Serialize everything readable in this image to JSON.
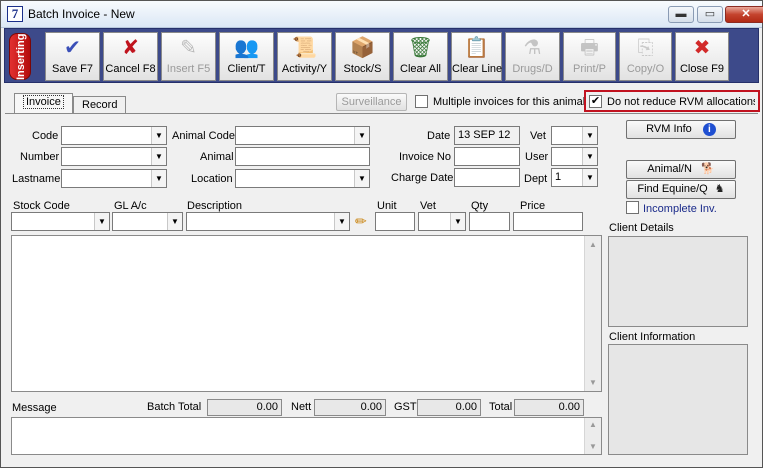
{
  "window": {
    "title": "Batch Invoice - New",
    "app_icon_glyph": "7",
    "controls": {
      "minimize": "▬",
      "maximize": "▭",
      "close": "✕"
    }
  },
  "toolbar": {
    "mode": "Inserting",
    "buttons": [
      {
        "label": "Save F7",
        "icon": "✔",
        "icon_name": "checkmark-icon",
        "color": "#3a4fb8",
        "enabled": true
      },
      {
        "label": "Cancel F8",
        "icon": "✘",
        "icon_name": "cancel-x-icon",
        "color": "#c0141e",
        "enabled": true
      },
      {
        "label": "Insert F5",
        "icon": "✎",
        "icon_name": "insert-pencil-icon",
        "color": "#777777",
        "enabled": false
      },
      {
        "label": "Client/T",
        "icon": "👥",
        "icon_name": "clients-icon",
        "color": "#333333",
        "enabled": true
      },
      {
        "label": "Activity/Y",
        "icon": "📜",
        "icon_name": "activity-scroll-icon",
        "color": "#2a4a8a",
        "enabled": true
      },
      {
        "label": "Stock/S",
        "icon": "📦",
        "icon_name": "stock-box-icon",
        "color": "#8a4a1a",
        "enabled": true
      },
      {
        "label": "Clear All",
        "icon": "🗑",
        "icon_name": "trash-can-icon",
        "color": "#3a7a3a",
        "enabled": true
      },
      {
        "label": "Clear Line",
        "icon": "📋",
        "icon_name": "clear-line-icon",
        "color": "#333333",
        "enabled": true
      },
      {
        "label": "Drugs/D",
        "icon": "⚗",
        "icon_name": "drugs-icon",
        "color": "#888888",
        "enabled": false
      },
      {
        "label": "Print/P",
        "icon": "🖶",
        "icon_name": "printer-icon",
        "color": "#888888",
        "enabled": false
      },
      {
        "label": "Copy/O",
        "icon": "⎘",
        "icon_name": "copy-icon",
        "color": "#999999",
        "enabled": false
      },
      {
        "label": "Close F9",
        "icon": "✖",
        "icon_name": "close-circle-icon",
        "color": "#d22a2a",
        "enabled": true
      }
    ]
  },
  "tabs": [
    {
      "label": "Invoice",
      "active": true
    },
    {
      "label": "Record",
      "active": false
    }
  ],
  "header_controls": {
    "surveillance_button": "Surveillance",
    "multiple_invoices_label": "Multiple invoices for this animal",
    "multiple_invoices_checked": false,
    "no_reduce_rvm_label": "Do not reduce RVM allocations",
    "no_reduce_rvm_checked": true
  },
  "form": {
    "code_label": "Code",
    "code_value": "",
    "number_label": "Number",
    "number_value": "",
    "lastname_label": "Lastname",
    "lastname_value": "",
    "animal_code_label": "Animal Code",
    "animal_code_value": "",
    "animal_label": "Animal",
    "animal_value": "",
    "location_label": "Location",
    "location_value": "",
    "date_label": "Date",
    "date_value": "13 SEP 12",
    "invoice_no_label": "Invoice No",
    "invoice_no_value": "",
    "charge_date_label": "Charge Date",
    "charge_date_value": "",
    "vet_label": "Vet",
    "vet_value": "",
    "user_label": "User",
    "user_value": "",
    "dept_label": "Dept",
    "dept_value": "1"
  },
  "right_panel": {
    "rvm_info_button": "RVM Info",
    "animal_button": "Animal/N",
    "find_equine_button": "Find Equine/Q",
    "incomplete_label": "Incomplete Inv.",
    "incomplete_checked": false,
    "client_details_label": "Client Details",
    "client_information_label": "Client Information"
  },
  "line_entry": {
    "columns": {
      "stock_code": "Stock Code",
      "gl_ac": "GL A/c",
      "description": "Description",
      "unit": "Unit",
      "vet": "Vet",
      "qty": "Qty",
      "price": "Price"
    }
  },
  "totals": {
    "message_label": "Message",
    "batch_total_label": "Batch Total",
    "batch_total_value": "0.00",
    "nett_label": "Nett",
    "nett_value": "0.00",
    "gst_label": "GST",
    "gst_value": "0.00",
    "total_label": "Total",
    "total_value": "0.00"
  }
}
